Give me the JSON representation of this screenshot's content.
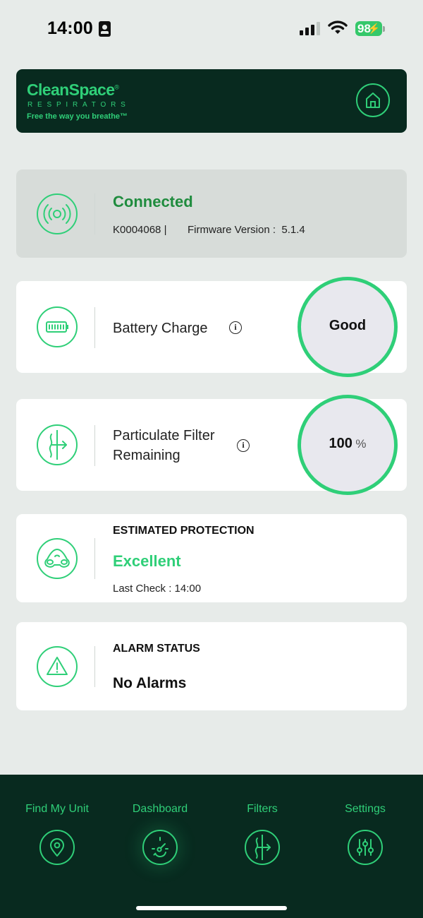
{
  "status_bar": {
    "time": "14:00",
    "battery_level": "98",
    "icons": [
      "id-badge-icon",
      "signal-icon",
      "wifi-icon",
      "battery-icon"
    ]
  },
  "header": {
    "brand_name": "CleanSpace",
    "brand_mark": "®",
    "brand_subtitle": "RESPIRATORS",
    "brand_tagline": "Free the way you breathe™",
    "home_icon": "home-icon"
  },
  "connection": {
    "status": "Connected",
    "serial": "K0004068 |",
    "firmware_label": "Firmware Version :",
    "firmware_version": "5.1.4",
    "icon": "wireless-signal-icon"
  },
  "battery": {
    "label": "Battery Charge",
    "info": "i",
    "value": "Good",
    "icon": "battery-icon"
  },
  "filter": {
    "label_line1": "Particulate Filter",
    "label_line2": "Remaining",
    "info": "i",
    "value": "100",
    "unit": "%",
    "icon": "filter-icon"
  },
  "protection": {
    "title": "ESTIMATED PROTECTION",
    "value": "Excellent",
    "last_check": "Last Check : 14:00",
    "icon": "respirator-mask-icon"
  },
  "alarm": {
    "title": "ALARM STATUS",
    "value": "No Alarms",
    "icon": "warning-triangle-icon"
  },
  "nav": {
    "items": [
      {
        "label": "Find My Unit",
        "icon": "location-pin-icon"
      },
      {
        "label": "Dashboard",
        "icon": "gauge-icon",
        "active": true
      },
      {
        "label": "Filters",
        "icon": "filter-icon"
      },
      {
        "label": "Settings",
        "icon": "sliders-icon"
      }
    ]
  },
  "colors": {
    "accent": "#2fcf78",
    "dark": "#082a1f",
    "connected_green": "#1f8c3e",
    "background": "#e7ebe9"
  }
}
